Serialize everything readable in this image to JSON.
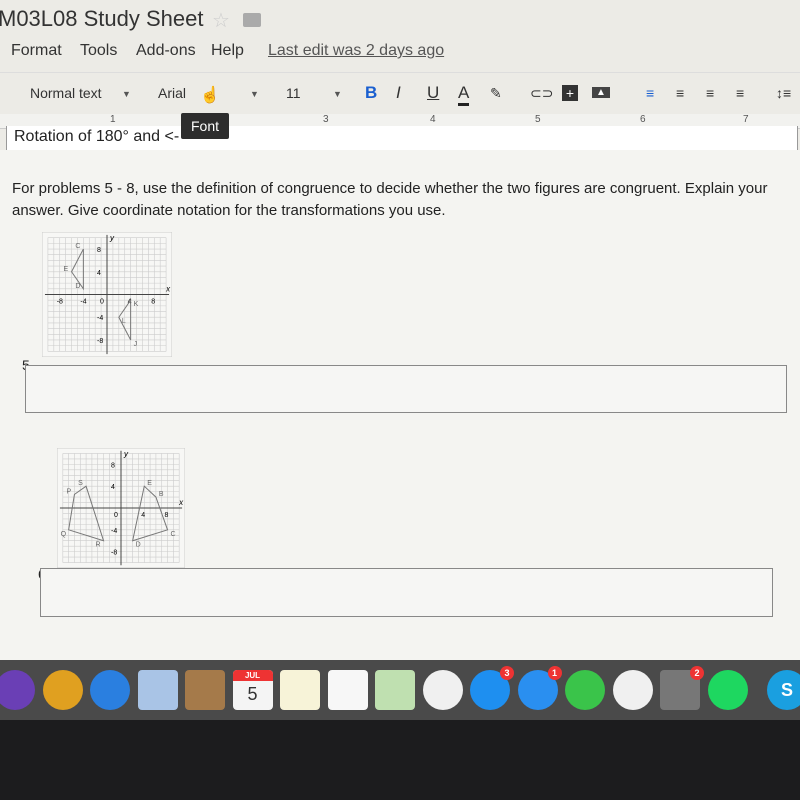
{
  "doc_title": "M03L08 Study Sheet",
  "menu": [
    "Format",
    "Tools",
    "Add-ons",
    "Help"
  ],
  "last_edit": "Last edit was 2 days ago",
  "toolbar": {
    "style": "Normal text",
    "font": "Arial",
    "size": "11",
    "bold": "B",
    "italic": "I",
    "underline": "U",
    "text_color": "A",
    "tooltip": "Font"
  },
  "ruler": [
    "1",
    "3",
    "4",
    "5",
    "6",
    "7"
  ],
  "previous_text": "Rotation of 180° and <-",
  "instructions": "For problems 5 - 8, use the definition of congruence to decide whether the two figures are congruent. Explain your answer. Give coordinate notation for the transformations you use.",
  "problems": [
    {
      "number": "5.",
      "answer": "",
      "graph": {
        "axis_labels": {
          "x": "x",
          "y": "y"
        },
        "ticks": {
          "x": [
            "-8",
            "-4",
            "4",
            "8"
          ],
          "y": [
            "8",
            "4",
            "-4",
            "-8"
          ]
        },
        "origin": "0",
        "figures": [
          {
            "points": [
              [
                "C",
                -4,
                8
              ],
              [
                "E",
                -6,
                4
              ],
              [
                "D",
                -4,
                1
              ]
            ]
          },
          {
            "points": [
              [
                "K",
                4,
                -1
              ],
              [
                "L",
                2,
                -4
              ],
              [
                "J",
                4,
                -8
              ]
            ]
          }
        ]
      }
    },
    {
      "number": "6.",
      "answer": "",
      "graph": {
        "axis_labels": {
          "x": "x",
          "y": "y"
        },
        "ticks": {
          "x": [
            "4",
            "8"
          ],
          "y": [
            "8",
            "4",
            "-4",
            "-8"
          ]
        },
        "origin": "0",
        "figures": [
          {
            "points": [
              [
                "P",
                -8,
                2.5
              ],
              [
                "S",
                -6,
                4
              ],
              [
                "R",
                -3,
                -6
              ],
              [
                "Q",
                -9,
                -4
              ]
            ]
          },
          {
            "points": [
              [
                "E",
                4,
                4
              ],
              [
                "B",
                6,
                2
              ],
              [
                "C",
                8,
                -4
              ],
              [
                "D",
                2,
                -6
              ]
            ]
          }
        ]
      }
    }
  ],
  "dock": [
    {
      "name": "siri",
      "color": "#6a3fb5"
    },
    {
      "name": "chrome",
      "color": "#e0a020"
    },
    {
      "name": "safari",
      "color": "#2a7fe0"
    },
    {
      "name": "mail",
      "color": "#a9c4e6"
    },
    {
      "name": "contacts",
      "color": "#a57a4a"
    },
    {
      "name": "calendar",
      "color": "#f4f4f4",
      "label": "5",
      "month": "JUL"
    },
    {
      "name": "notes",
      "color": "#f7f3d8"
    },
    {
      "name": "reminders",
      "color": "#f7f7f7"
    },
    {
      "name": "maps",
      "color": "#bfe0b0"
    },
    {
      "name": "photos",
      "color": "#f0f0f0"
    },
    {
      "name": "app-store",
      "color": "#1e8ff0",
      "badge": "3"
    },
    {
      "name": "messages",
      "color": "#2a8ff0",
      "badge": "1"
    },
    {
      "name": "facetime",
      "color": "#3ac44a"
    },
    {
      "name": "itunes",
      "color": "#f0f0f0"
    },
    {
      "name": "system-preferences",
      "color": "#777",
      "badge": "2"
    },
    {
      "name": "spotify",
      "color": "#1ed760"
    },
    {
      "name": "skype",
      "color": "#1a9fe0",
      "label": "S"
    }
  ]
}
